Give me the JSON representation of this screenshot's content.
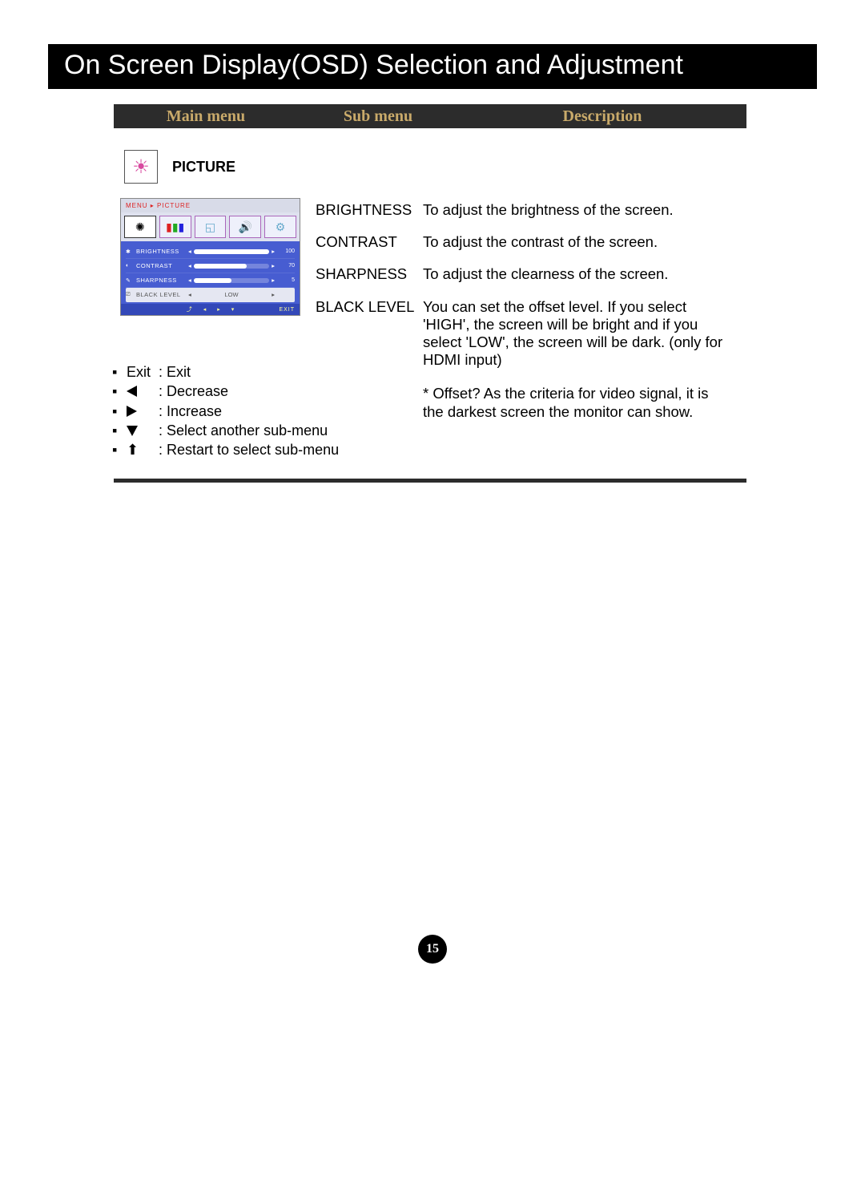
{
  "page": {
    "title": "On Screen Display(OSD) Selection and Adjustment",
    "number": "15"
  },
  "header": {
    "main": "Main menu",
    "sub": "Sub menu",
    "desc": "Description"
  },
  "section": {
    "label": "PICTURE",
    "icon": "brightness-icon"
  },
  "osd": {
    "breadcrumb": "MENU ▸ PICTURE",
    "tabs": [
      "brightness-tab-icon",
      "color-tab-icon",
      "display-tab-icon",
      "volume-tab-icon",
      "settings-tab-icon"
    ],
    "rows": [
      {
        "icon": "✱",
        "label": "BRIGHTNESS",
        "value": "100",
        "fill": 100
      },
      {
        "icon": "◐",
        "label": "CONTRAST",
        "value": "70",
        "fill": 70
      },
      {
        "icon": "✎",
        "label": "SHARPNESS",
        "value": "5",
        "fill": 50
      }
    ],
    "blacklevel": {
      "icon": "⎚",
      "label": "BLACK LEVEL",
      "value": "LOW"
    },
    "footer_exit": "EXIT"
  },
  "legend": {
    "items": [
      {
        "icon": "text",
        "glyph": "Exit",
        "text": ": Exit"
      },
      {
        "icon": "tri-left",
        "text": ": Decrease"
      },
      {
        "icon": "tri-right",
        "text": ": Increase"
      },
      {
        "icon": "tri-down",
        "text": ": Select another sub-menu"
      },
      {
        "icon": "home",
        "text": ": Restart to select sub-menu"
      }
    ]
  },
  "submenus": [
    {
      "name": "BRIGHTNESS",
      "desc": "To adjust the brightness of the screen."
    },
    {
      "name": "CONTRAST",
      "desc": "To adjust the contrast of the screen."
    },
    {
      "name": "SHARPNESS",
      "desc": "To adjust the clearness of the screen."
    },
    {
      "name": "BLACK LEVEL",
      "desc": "You can set the offset level. If you select 'HIGH', the screen will be bright and if you select 'LOW', the screen will be dark. (only for HDMI input)"
    }
  ],
  "offset_note": "* Offset?  As the criteria for video signal, it is the darkest screen the monitor can show."
}
